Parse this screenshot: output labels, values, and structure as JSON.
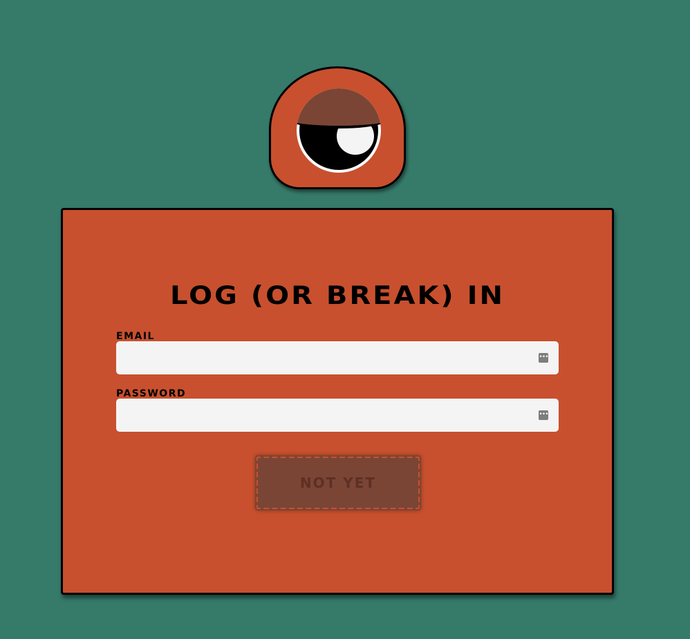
{
  "login": {
    "title": "LOG (OR BREAK) IN",
    "email_label": "EMAIL",
    "email_value": "",
    "password_label": "PASSWORD",
    "password_value": "",
    "submit_label": "NOT YET",
    "submit_state": "disabled"
  },
  "icons": {
    "mascot": "one-eyed-monster-icon",
    "field_autofill": "password-manager-key-icon"
  },
  "colors": {
    "background": "#367a6a",
    "card": "#c8502e",
    "button": "#7a4535",
    "field": "#f4f4f4"
  }
}
